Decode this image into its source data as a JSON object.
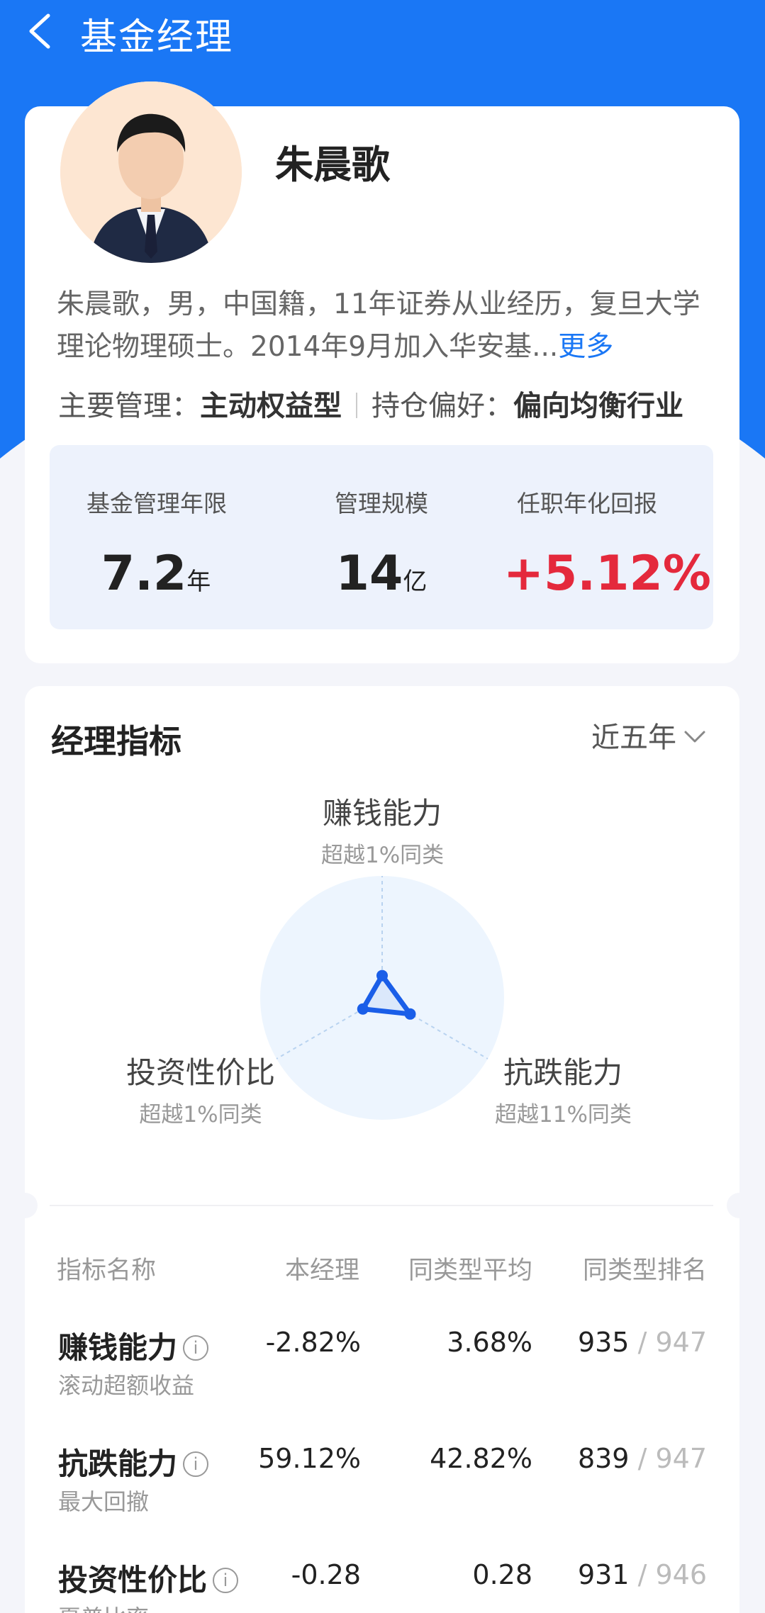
{
  "nav": {
    "title": "基金经理"
  },
  "manager": {
    "name": "朱晨歌",
    "bio": "朱晨歌，男，中国籍，11年证券从业经历，复旦大学理论物理硕士。2014年9月加入华安基",
    "bio_ellipsis": "...",
    "more_label": "更多",
    "main_manage_label": "主要管理：",
    "main_manage_value": "主动权益型",
    "preference_label": "持仓偏好：",
    "preference_value": "偏向均衡行业"
  },
  "stats": [
    {
      "label": "基金管理年限",
      "value": "7.2",
      "unit": "年"
    },
    {
      "label": "管理规模",
      "value": "14",
      "unit": "亿"
    },
    {
      "label": "任职年化回报",
      "value": "+5.12%",
      "unit": ""
    }
  ],
  "indicators": {
    "title": "经理指标",
    "period": "近五年",
    "radar": [
      {
        "name": "赚钱能力",
        "sub": "超越1%同类",
        "percentile": 1
      },
      {
        "name": "抗跌能力",
        "sub": "超越11%同类",
        "percentile": 11
      },
      {
        "name": "投资性价比",
        "sub": "超越1%同类",
        "percentile": 1
      }
    ],
    "table": {
      "headers": [
        "指标名称",
        "本经理",
        "同类型平均",
        "同类型排名"
      ],
      "rows": [
        {
          "name": "赚钱能力",
          "sub": "滚动超额收益",
          "mine": "-2.82%",
          "avg": "3.68%",
          "rank": "935",
          "total": "/ 947"
        },
        {
          "name": "抗跌能力",
          "sub": "最大回撤",
          "mine": "59.12%",
          "avg": "42.82%",
          "rank": "839",
          "total": "/ 947"
        },
        {
          "name": "投资性价比",
          "sub": "夏普比率",
          "mine": "-0.28",
          "avg": "0.28",
          "rank": "931",
          "total": "/ 946"
        }
      ]
    }
  },
  "colors": {
    "accent": "#1a77f5",
    "positive": "#e4293c"
  }
}
